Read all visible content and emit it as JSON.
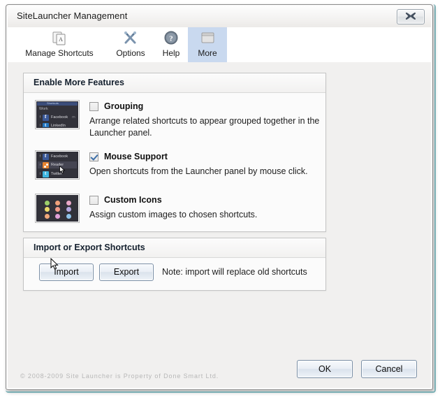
{
  "window": {
    "title": "SiteLauncher Management",
    "close_icon": "close-icon"
  },
  "toolbar": {
    "tabs": [
      {
        "label": "Manage Shortcuts",
        "icon": "documents-icon",
        "selected": false
      },
      {
        "label": "Options",
        "icon": "tools-icon",
        "selected": false
      },
      {
        "label": "Help",
        "icon": "question-circle-icon",
        "selected": false
      },
      {
        "label": "More",
        "icon": "window-panel-icon",
        "selected": true
      }
    ]
  },
  "features_group": {
    "header": "Enable More Features",
    "items": [
      {
        "name": "Grouping",
        "checked": false,
        "description": "Arrange related shortcuts to appear grouped together in the Launcher panel.",
        "thumbnail": {
          "kind": "launcher-panel-grouped",
          "group_label": "Work",
          "entries": [
            {
              "key": "f",
              "label": "Facebook",
              "favicon": "facebook"
            }
          ]
        }
      },
      {
        "name": "Mouse Support",
        "checked": true,
        "description": "Open shortcuts from the Launcher panel by mouse click.",
        "thumbnail": {
          "kind": "launcher-panel-mouse",
          "entries": [
            {
              "key": "f",
              "label": "Facebook",
              "favicon": "facebook"
            },
            {
              "key": "r",
              "label": "Reader",
              "favicon": "reader"
            },
            {
              "key": "t",
              "label": "Twitter",
              "favicon": "twitter"
            }
          ]
        }
      },
      {
        "name": "Custom Icons",
        "checked": false,
        "description": "Assign custom images to chosen shortcuts.",
        "thumbnail": {
          "kind": "icon-dot-grid",
          "dot_colors": [
            "#9ccf6a",
            "#f0a07a",
            "#e9a8c8",
            "#ecd96a",
            "#f09a8a",
            "#b4a8e0",
            "#f0a87a",
            "#e0a0d8",
            "#8ec3ea"
          ]
        }
      }
    ]
  },
  "import_group": {
    "header": "Import or Export Shortcuts",
    "import_label": "Import",
    "export_label": "Export",
    "note": "Note: import will replace old shortcuts"
  },
  "footer": {
    "copyright": "© 2008-2009 Site Launcher is Property of Done Smart Ltd.",
    "ok_label": "OK",
    "cancel_label": "Cancel"
  },
  "colors": {
    "selected_tab": "#c9d9ef",
    "window_bg": "#f1f0ef",
    "group_bg": "#fbfbfb",
    "accent_edge": "#69a7ad",
    "checkmark": "#3d6fa8"
  }
}
